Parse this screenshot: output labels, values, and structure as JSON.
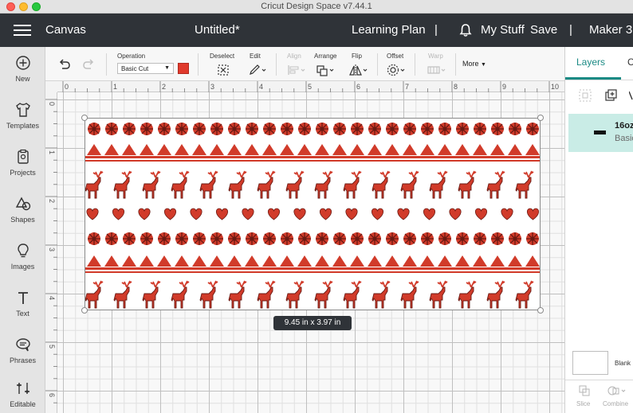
{
  "window": {
    "title": "Cricut Design Space  v7.44.1"
  },
  "header": {
    "section": "Canvas",
    "project_title": "Untitled*",
    "learning_plan": "Learning Plan",
    "separator": "|",
    "my_stuff": "My Stuff",
    "save": "Save",
    "machine": "Maker 3"
  },
  "left_rail": [
    {
      "label": "New",
      "icon": "plus-circle-icon"
    },
    {
      "label": "Templates",
      "icon": "tshirt-icon"
    },
    {
      "label": "Projects",
      "icon": "clipboard-icon"
    },
    {
      "label": "Shapes",
      "icon": "shapes-icon"
    },
    {
      "label": "Images",
      "icon": "lightbulb-icon"
    },
    {
      "label": "Text",
      "icon": "text-icon"
    },
    {
      "label": "Phrases",
      "icon": "speech-bubble-icon"
    },
    {
      "label": "Editable",
      "icon": "editable-icon"
    }
  ],
  "toolbar": {
    "operation_label": "Operation",
    "operation_value": "Basic Cut",
    "operation_color": "#e03a2c",
    "deselect": "Deselect",
    "edit": "Edit",
    "align": "Align",
    "arrange": "Arrange",
    "flip": "Flip",
    "offset": "Offset",
    "warp": "Warp",
    "more": "More"
  },
  "ruler": {
    "top_ticks": [
      "0",
      "1",
      "2",
      "3",
      "4",
      "5",
      "6",
      "7",
      "8",
      "9",
      "10"
    ],
    "left_ticks": [
      "0",
      "1",
      "2",
      "3",
      "4",
      "5",
      "6"
    ]
  },
  "canvas": {
    "selection_size": "9.45  in x 3.97  in",
    "design_color": "#d13b2a"
  },
  "right_panel": {
    "tab_layers": "Layers",
    "tab_color": "C",
    "layer_name": "16oz",
    "layer_operation": "Basic",
    "blank_label": "Blank",
    "slice": "Slice",
    "combine": "Combine"
  }
}
